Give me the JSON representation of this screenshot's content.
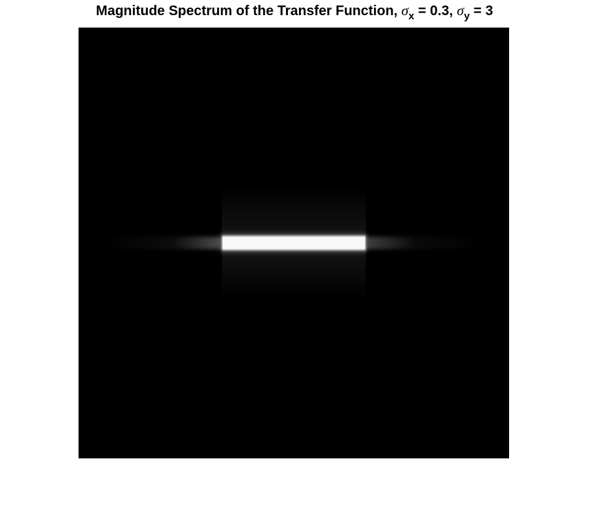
{
  "chart_data": {
    "type": "heatmap",
    "title": {
      "prefix": "Magnitude Spectrum of the Transfer Function, ",
      "sigma_x_symbol": "σ",
      "sigma_x_subscript": "x",
      "sigma_x_value": " = 0.3, ",
      "sigma_y_symbol": "σ",
      "sigma_y_subscript": "y",
      "sigma_y_value": " = 3"
    },
    "parameters": {
      "sigma_x": 0.3,
      "sigma_y": 3
    },
    "colormap": "gray",
    "background_color": "#000000",
    "feature_color": "#f8f8f8",
    "axes_visible": false,
    "grid": false,
    "legend": "none",
    "features": [
      {
        "name": "central-bright-band",
        "shape": "horizontal-band",
        "x_range": [
          0.333,
          0.667
        ],
        "y_center": 0.5,
        "thickness": 0.034,
        "intensity": 0.97
      },
      {
        "name": "horizontal-glow-left",
        "shape": "fading-streak",
        "x_range": [
          0.05,
          0.333
        ],
        "y_center": 0.5,
        "intensity": 0.25
      },
      {
        "name": "horizontal-glow-right",
        "shape": "fading-streak",
        "x_range": [
          0.667,
          0.95
        ],
        "y_center": 0.5,
        "intensity": 0.2
      },
      {
        "name": "vertical-glow",
        "shape": "faint-column",
        "x_range": [
          0.333,
          0.667
        ],
        "y_range": [
          0.37,
          0.63
        ],
        "intensity": 0.04
      }
    ]
  }
}
